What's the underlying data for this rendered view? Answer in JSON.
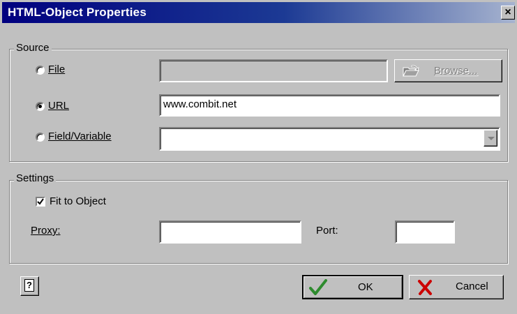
{
  "window": {
    "title": "HTML-Object Properties",
    "close_label": "×"
  },
  "source": {
    "legend": "Source",
    "options": {
      "file": {
        "label": "File",
        "selected": false
      },
      "url": {
        "label": "URL",
        "selected": true
      },
      "field": {
        "label": "Field/Variable",
        "selected": false
      }
    },
    "file_value": "",
    "browse_label": "Browse...",
    "url_value": "www.combit.net",
    "field_value": ""
  },
  "settings": {
    "legend": "Settings",
    "fit_to_object": {
      "label": "Fit to Object",
      "checked": true
    },
    "proxy_label": "Proxy:",
    "proxy_value": "",
    "port_label": "Port:",
    "port_value": ""
  },
  "buttons": {
    "help_label": "?",
    "ok_label": "OK",
    "cancel_label": "Cancel"
  },
  "colors": {
    "titlebar_start": "#00007f",
    "titlebar_end": "#a6b3cf",
    "ok_check": "#2e8b2e",
    "cancel_x": "#cc0000"
  }
}
